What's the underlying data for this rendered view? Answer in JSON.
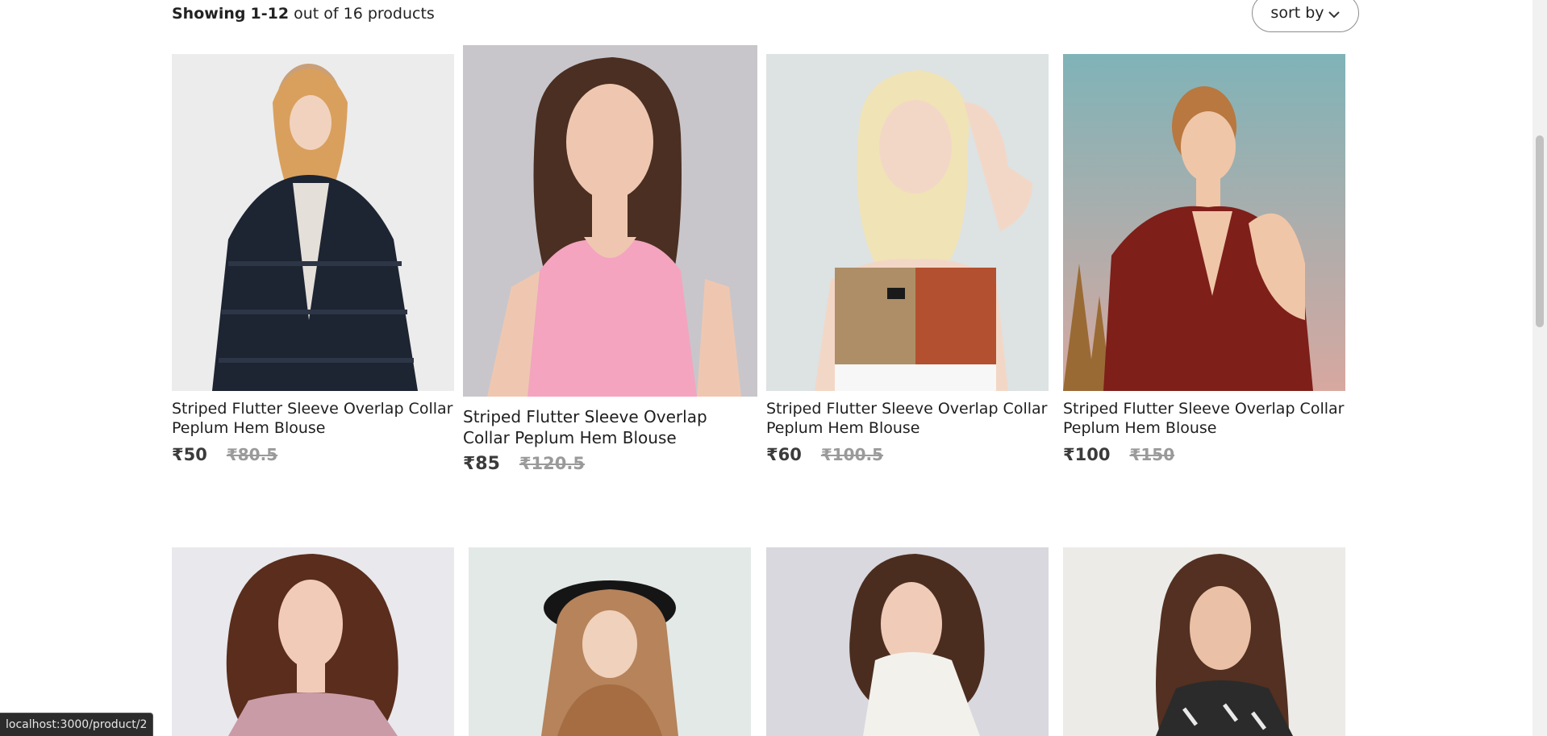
{
  "toolbar": {
    "showing_prefix": "Showing",
    "showing_range": "1-12",
    "showing_suffix": "out of 16 products",
    "sort_label": "sort by"
  },
  "products": [
    {
      "title": "Striped Flutter Sleeve Overlap Collar Peplum Hem Blouse",
      "price": "₹50",
      "mrp": "₹80.5"
    },
    {
      "title": "Striped Flutter Sleeve Overlap Collar Peplum Hem Blouse",
      "price": "₹85",
      "mrp": "₹120.5"
    },
    {
      "title": "Striped Flutter Sleeve Overlap Collar Peplum Hem Blouse",
      "price": "₹60",
      "mrp": "₹100.5"
    },
    {
      "title": "Striped Flutter Sleeve Overlap Collar Peplum Hem Blouse",
      "price": "₹100",
      "mrp": "₹150"
    }
  ],
  "status_url": "localhost:3000/product/2"
}
